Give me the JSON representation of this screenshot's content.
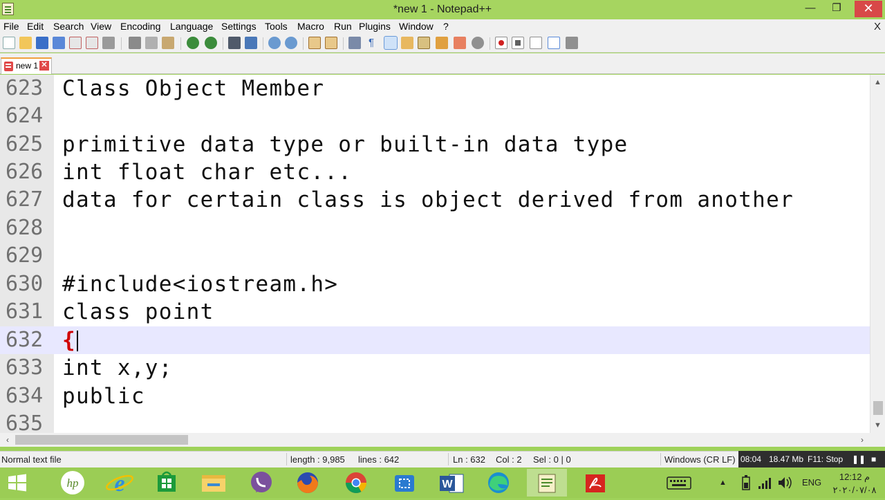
{
  "window": {
    "title": "*new 1 - Notepad++",
    "controls": {
      "minimize": "—",
      "restore": "❐",
      "close": "✕"
    }
  },
  "menu": {
    "items": [
      "File",
      "Edit",
      "Search",
      "View",
      "Encoding",
      "Language",
      "Settings",
      "Tools",
      "Macro",
      "Run",
      "Plugins",
      "Window",
      "?"
    ],
    "close_label": "X"
  },
  "toolbar": {
    "icons": [
      "new-file-icon",
      "open-file-icon",
      "save-icon",
      "save-all-icon",
      "close-icon",
      "close-all-icon",
      "print-icon",
      "cut-icon",
      "copy-icon",
      "paste-icon",
      "undo-icon",
      "redo-icon",
      "find-icon",
      "replace-icon",
      "zoom-in-icon",
      "zoom-out-icon",
      "sync-vertical-icon",
      "sync-horizontal-icon",
      "word-wrap-icon",
      "show-all-chars-icon",
      "indent-guide-icon",
      "doc-map-icon",
      "function-list-icon",
      "folder-workspace-icon",
      "monitoring-icon",
      "record-macro-icon",
      "stop-record-icon",
      "play-macro-icon",
      "run-macro-multiple-icon",
      "save-macro-icon"
    ],
    "active_icon": "indent-guide-icon"
  },
  "tabs": [
    {
      "label": "new 1",
      "close": "✕"
    }
  ],
  "editor": {
    "lines": [
      {
        "num": "623",
        "text": "Class Object Member"
      },
      {
        "num": "624",
        "text": ""
      },
      {
        "num": "625",
        "text": "primitive data type or built-in data type"
      },
      {
        "num": "626",
        "text": "int float char etc..."
      },
      {
        "num": "627",
        "text": "data for certain class is object derived from another"
      },
      {
        "num": "628",
        "text": ""
      },
      {
        "num": "629",
        "text": ""
      },
      {
        "num": "630",
        "text": "#include<iostream.h>"
      },
      {
        "num": "631",
        "text": "class point"
      },
      {
        "num": "632",
        "text": "{"
      },
      {
        "num": "633",
        "text": "int x,y;"
      },
      {
        "num": "634",
        "text": "public"
      },
      {
        "num": "635",
        "text": ""
      }
    ],
    "current_line": "632"
  },
  "status": {
    "file_type": "Normal text file",
    "length": "length : 9,985",
    "lines": "lines : 642",
    "ln": "Ln : 632",
    "col": "Col : 2",
    "sel": "Sel : 0 | 0",
    "eol": "Windows (CR LF)"
  },
  "recorder": {
    "time": "08:04",
    "size": "18.47 Mb",
    "hint": "F11: Stop",
    "pause": "❚❚",
    "stop": "■"
  },
  "taskbar": {
    "apps": [
      "start-icon",
      "hp-icon",
      "internet-explorer-icon",
      "store-icon",
      "file-explorer-icon",
      "viber-icon",
      "firefox-icon",
      "chrome-icon",
      "snipping-tool-icon",
      "word-icon",
      "edge-icon",
      "notepadpp-icon",
      "acrobat-icon"
    ],
    "active_app": "notepadpp-icon",
    "tray": {
      "language": "ENG",
      "time": "12:12 م",
      "date": "٢٠٢٠/٠٧/٠٨"
    }
  },
  "colors": {
    "title_bar": "#a6d560",
    "taskbar": "#9bcd55",
    "current_line": "#e8e8ff",
    "brace": "#d00000",
    "line_number": "#707070"
  }
}
